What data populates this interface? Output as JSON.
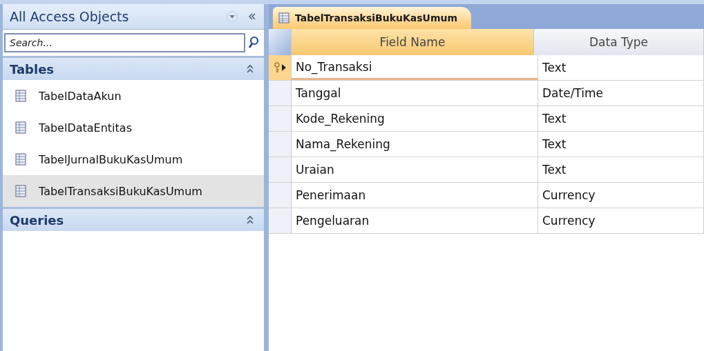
{
  "nav_pane": {
    "title": "All Access Objects",
    "search": {
      "placeholder": "Search..."
    },
    "groups": [
      {
        "label": "Tables",
        "expanded": true,
        "items": [
          {
            "label": "TabelDataAkun",
            "selected": false
          },
          {
            "label": "TabelDataEntitas",
            "selected": false
          },
          {
            "label": "TabelJurnalBukuKasUmum",
            "selected": false
          },
          {
            "label": "TabelTransaksiBukuKasUmum",
            "selected": true
          }
        ]
      },
      {
        "label": "Queries",
        "expanded": true
      }
    ]
  },
  "tabs": [
    {
      "label": "TabelTransaksiBukuKasUmum",
      "selected": true
    }
  ],
  "table": {
    "columns": [
      "Field Name",
      "Data Type"
    ],
    "rows": [
      {
        "field": "No_Transaksi",
        "type": "Text",
        "primary_key": true,
        "selected": true
      },
      {
        "field": "Tanggal",
        "type": "Date/Time",
        "primary_key": false,
        "selected": false
      },
      {
        "field": "Kode_Rekening",
        "type": "Text",
        "primary_key": false,
        "selected": false
      },
      {
        "field": "Nama_Rekening",
        "type": "Text",
        "primary_key": false,
        "selected": false
      },
      {
        "field": "Uraian",
        "type": "Text",
        "primary_key": false,
        "selected": false
      },
      {
        "field": "Penerimaan",
        "type": "Currency",
        "primary_key": false,
        "selected": false
      },
      {
        "field": "Pengeluaran",
        "type": "Currency",
        "primary_key": false,
        "selected": false
      }
    ]
  }
}
